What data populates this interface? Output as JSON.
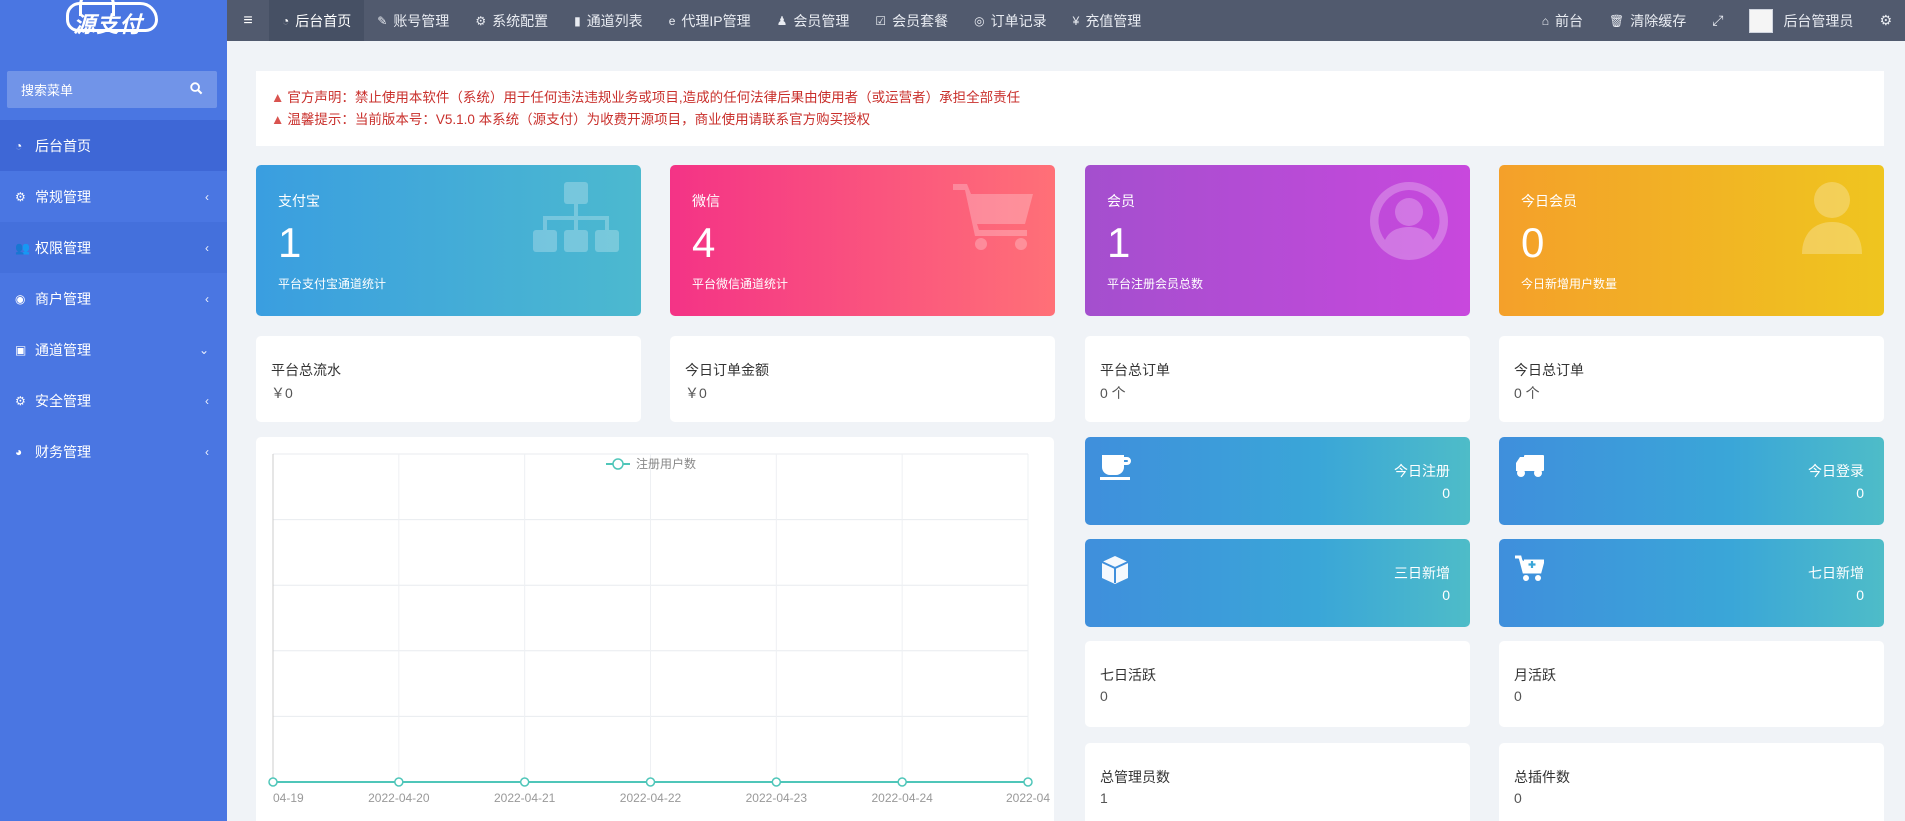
{
  "brand": {
    "logo_text": "源支付"
  },
  "sidebar": {
    "search_placeholder": "搜索菜单",
    "items": [
      {
        "label": "后台首页",
        "icon": "dashboard-icon",
        "arrow": ""
      },
      {
        "label": "常规管理",
        "icon": "cogs-icon",
        "arrow": "‹"
      },
      {
        "label": "权限管理",
        "icon": "users-icon",
        "arrow": "‹"
      },
      {
        "label": "商户管理",
        "icon": "user-circle-icon",
        "arrow": "‹"
      },
      {
        "label": "通道管理",
        "icon": "font-icon",
        "arrow": "⌄"
      },
      {
        "label": "安全管理",
        "icon": "gear-icon",
        "arrow": "‹"
      },
      {
        "label": "财务管理",
        "icon": "pie-chart-icon",
        "arrow": "‹"
      }
    ]
  },
  "topnav": {
    "tabs": [
      {
        "label": "后台首页",
        "icon": "dashboard-icon"
      },
      {
        "label": "账号管理",
        "icon": "edit-icon"
      },
      {
        "label": "系统配置",
        "icon": "gear-icon"
      },
      {
        "label": "通道列表",
        "icon": "signal-icon"
      },
      {
        "label": "代理IP管理",
        "icon": "ie-icon"
      },
      {
        "label": "会员管理",
        "icon": "user-icon"
      },
      {
        "label": "会员套餐",
        "icon": "check-square-icon"
      },
      {
        "label": "订单记录",
        "icon": "chrome-icon"
      },
      {
        "label": "充值管理",
        "icon": "yen-icon"
      }
    ],
    "right": {
      "home_label": "前台",
      "clear_cache_label": "清除缓存",
      "admin_label": "后台管理员"
    }
  },
  "notice": {
    "line1": "官方声明：禁止使用本软件（系统）用于任何违法违规业务或项目,造成的任何法律后果由使用者（或运营者）承担全部责任",
    "line2": "温馨提示：当前版本号：V5.1.0 本系统（源支付）为收费开源项目，商业使用请联系官方购买授权"
  },
  "stats": [
    {
      "label": "支付宝",
      "value": "1",
      "sub": "平台支付宝通道统计",
      "icon": "sitemap-icon"
    },
    {
      "label": "微信",
      "value": "4",
      "sub": "平台微信通道统计",
      "icon": "shopping-cart-icon"
    },
    {
      "label": "会员",
      "value": "1",
      "sub": "平台注册会员总数",
      "icon": "user-circle-icon"
    },
    {
      "label": "今日会员",
      "value": "0",
      "sub": "今日新增用户数量",
      "icon": "user-icon"
    }
  ],
  "totals": [
    {
      "label": "平台总流水",
      "value": "￥0"
    },
    {
      "label": "今日订单金额",
      "value": "￥0"
    },
    {
      "label": "平台总订单",
      "value": "0 个"
    },
    {
      "label": "今日总订单",
      "value": "0 个"
    }
  ],
  "mini_stats": [
    {
      "label": "今日注册",
      "value": "0",
      "icon": "coffee-icon"
    },
    {
      "label": "今日登录",
      "value": "0",
      "icon": "truck-icon"
    },
    {
      "label": "三日新增",
      "value": "0",
      "icon": "cube-icon"
    },
    {
      "label": "七日新增",
      "value": "0",
      "icon": "cart-plus-icon"
    }
  ],
  "activity": [
    {
      "label": "七日活跃",
      "value": "0"
    },
    {
      "label": "月活跃",
      "value": "0"
    },
    {
      "label": "总管理员数",
      "value": "1"
    },
    {
      "label": "总插件数",
      "value": "0"
    }
  ],
  "chart_data": {
    "type": "line",
    "legend": [
      "注册用户数"
    ],
    "legend_position": "top",
    "x": [
      "04-19",
      "2022-04-20",
      "2022-04-21",
      "2022-04-22",
      "2022-04-23",
      "2022-04-24",
      "2022-04"
    ],
    "series": [
      {
        "name": "注册用户数",
        "values": [
          0,
          0,
          0,
          0,
          0,
          0,
          0
        ]
      }
    ],
    "grid": true,
    "colors": {
      "line": "#4fc6b9"
    }
  }
}
